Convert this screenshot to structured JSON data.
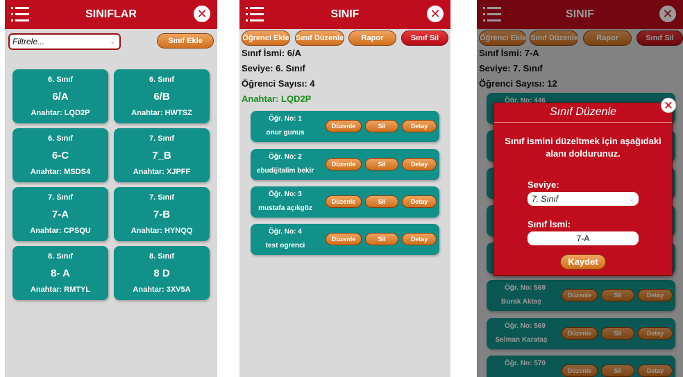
{
  "classes_screen": {
    "title": "SINIFLAR",
    "filter_placeholder": "Filtrele...",
    "add_class_label": "Sınıf Ekle",
    "cards": [
      {
        "level": "6. Sınıf",
        "name": "6/A",
        "key": "Anahtar: LQD2P"
      },
      {
        "level": "6. Sınıf",
        "name": "6/B",
        "key": "Anahtar: HWTSZ"
      },
      {
        "level": "6. Sınıf",
        "name": "6-C",
        "key": "Anahtar: MSDS4"
      },
      {
        "level": "7. Sınıf",
        "name": "7_B",
        "key": "Anahtar: XJPFF"
      },
      {
        "level": "7. Sınıf",
        "name": "7-A",
        "key": "Anahtar: CPSQU"
      },
      {
        "level": "7. Sınıf",
        "name": "7-B",
        "key": "Anahtar: HYNQQ"
      },
      {
        "level": "8. Sınıf",
        "name": "8- A",
        "key": "Anahtar: RMTYL"
      },
      {
        "level": "8. Sınıf",
        "name": "8 D",
        "key": "Anahtar: 3XV5A"
      }
    ]
  },
  "class_screen": {
    "title": "SINIF",
    "buttons": {
      "add_student": "Öğrenci Ekle",
      "edit_class": "Sınıf Düzenle",
      "report": "Rapor",
      "delete_class": "Sınıf Sil"
    },
    "info": {
      "name": "Sınıf İsmi: 6/A",
      "level": "Seviye: 6. Sınıf",
      "count": "Öğrenci Sayısı: 4",
      "key": "Anahtar: LQD2P"
    },
    "student_buttons": {
      "edit": "Düzenle",
      "delete": "Sil",
      "detail": "Detay"
    },
    "students": [
      {
        "no": "Öğr. No: 1",
        "name": "onur gunus"
      },
      {
        "no": "Öğr. No: 2",
        "name": "ebudijitalim bekir"
      },
      {
        "no": "Öğr. No: 3",
        "name": "mustafa açıkgöz"
      },
      {
        "no": "Öğr. No: 4",
        "name": "test ogrenci"
      }
    ]
  },
  "edit_screen": {
    "title": "SINIF",
    "buttons": {
      "add_student": "Öğrenci Ekle",
      "edit_class": "Sınıf Düzenle",
      "report": "Rapor",
      "delete_class": "Sınıf Sil"
    },
    "info": {
      "name": "Sınıf İsmi: 7-A",
      "level": "Seviye: 7. Sınıf",
      "count": "Öğrenci Sayısı: 12"
    },
    "student_buttons": {
      "edit": "Düzenle",
      "delete": "Sil",
      "detail": "Detay"
    },
    "students": [
      {
        "no": "Öğr. No: 446",
        "name": ""
      },
      {
        "no": "",
        "name": ""
      },
      {
        "no": "",
        "name": ""
      },
      {
        "no": "",
        "name": ""
      },
      {
        "no": "",
        "name": ""
      },
      {
        "no": "Öğr. No: 568",
        "name": "Burak Aktaş"
      },
      {
        "no": "Öğr. No: 569",
        "name": "Selman Karataş"
      },
      {
        "no": "Öğr. No: 570",
        "name": ""
      }
    ],
    "modal": {
      "title": "Sınıf Düzenle",
      "description": "Sınıf ismini düzeltmek için aşağıdaki alanı doldurunuz.",
      "level_label": "Seviye:",
      "level_value": "7. Sınıf",
      "name_label": "Sınıf İsmi:",
      "name_value": "7-A",
      "save_label": "Kaydet"
    }
  }
}
